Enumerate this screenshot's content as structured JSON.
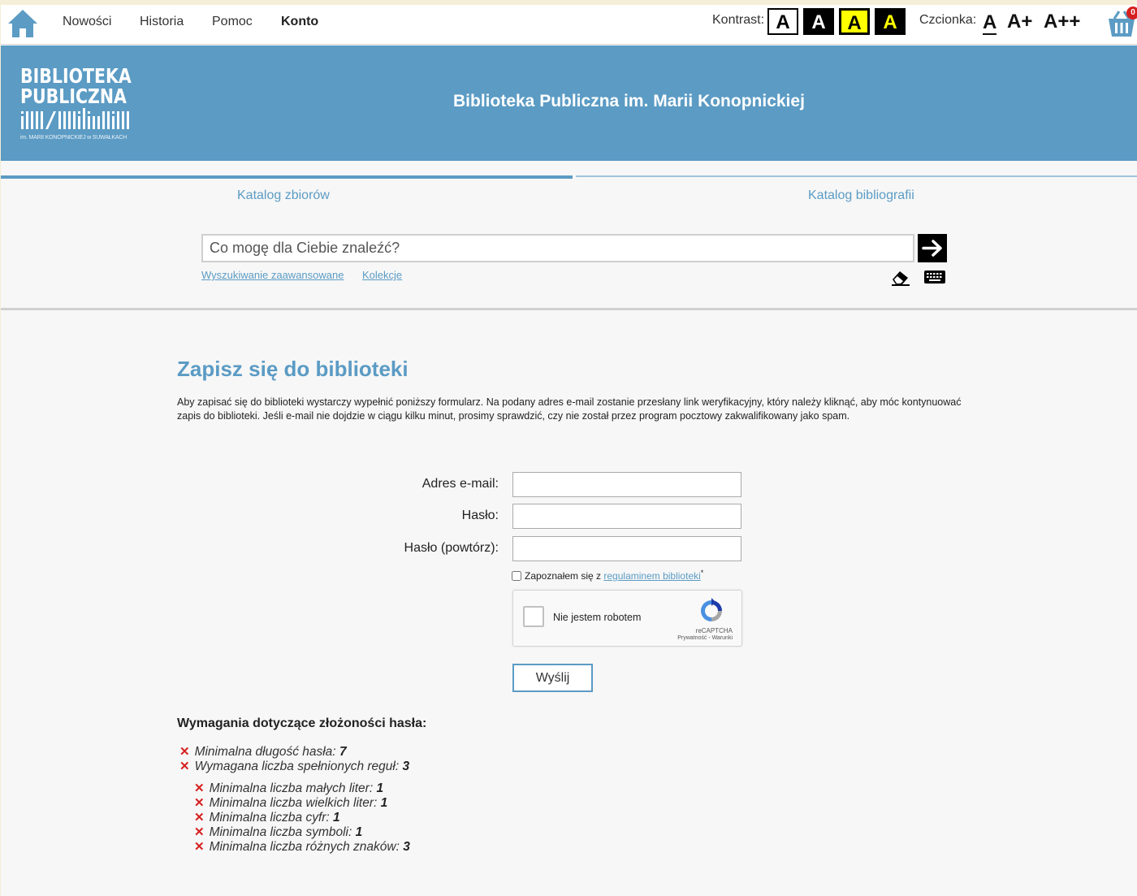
{
  "topbar": {
    "nav": [
      "Nowości",
      "Historia",
      "Pomoc",
      "Konto"
    ],
    "kontrast_label": "Kontrast:",
    "kontrast_options": [
      "A",
      "A",
      "A",
      "A"
    ],
    "czcionka_label": "Czcionka:",
    "font_sizes": [
      "A",
      "A+",
      "A++"
    ],
    "cart_count": "0"
  },
  "header": {
    "logo_line1": "BIBLIOTEKA",
    "logo_line2": "PUBLICZNA",
    "logo_sub": "im. MARII KONOPNICKIEJ w SUWAŁKACH",
    "title": "Biblioteka Publiczna im. Marii Konopnickiej"
  },
  "tabs": [
    "Katalog zbiorów",
    "Katalog bibliografii"
  ],
  "search": {
    "placeholder": "Co mogę dla Ciebie znaleźć?",
    "links": [
      "Wyszukiwanie zaawansowane",
      "Kolekcje"
    ]
  },
  "main": {
    "title": "Zapisz się do biblioteki",
    "intro": "Aby zapisać się do biblioteki wystarczy wypełnić poniższy formularz. Na podany adres e-mail zostanie przesłany link weryfikacyjny, który należy kliknąć, aby móc kontynuować zapis do biblioteki. Jeśli e-mail nie dojdzie w ciągu kilku minut, prosimy sprawdzić, czy nie został przez program pocztowy zakwalifikowany jako spam.",
    "form": {
      "email_label": "Adres e-mail:",
      "password_label": "Hasło:",
      "password_repeat_label": "Hasło (powtórz):",
      "terms_prefix": "Zapoznałem się z ",
      "terms_link": "regulaminem biblioteki",
      "terms_required": "*",
      "captcha_label": "Nie jestem robotem",
      "captcha_brand": "reCAPTCHA",
      "captcha_terms": "Prywatność - Warunki",
      "submit": "Wyślij"
    },
    "requirements": {
      "title": "Wymagania dotyczące złożoności hasła:",
      "items": [
        {
          "label": "Minimalna długość hasła:",
          "value": "7"
        },
        {
          "label": "Wymagana liczba spełnionych reguł:",
          "value": "3"
        }
      ],
      "rules": [
        {
          "label": "Minimalna liczba małych liter:",
          "value": "1"
        },
        {
          "label": "Minimalna liczba wielkich liter:",
          "value": "1"
        },
        {
          "label": "Minimalna liczba cyfr:",
          "value": "1"
        },
        {
          "label": "Minimalna liczba symboli:",
          "value": "1"
        },
        {
          "label": "Minimalna liczba różnych znaków:",
          "value": "3"
        }
      ]
    }
  },
  "colors": {
    "accent": "#5b9bc4",
    "error": "#d62020",
    "highlight": "#ffff00"
  }
}
